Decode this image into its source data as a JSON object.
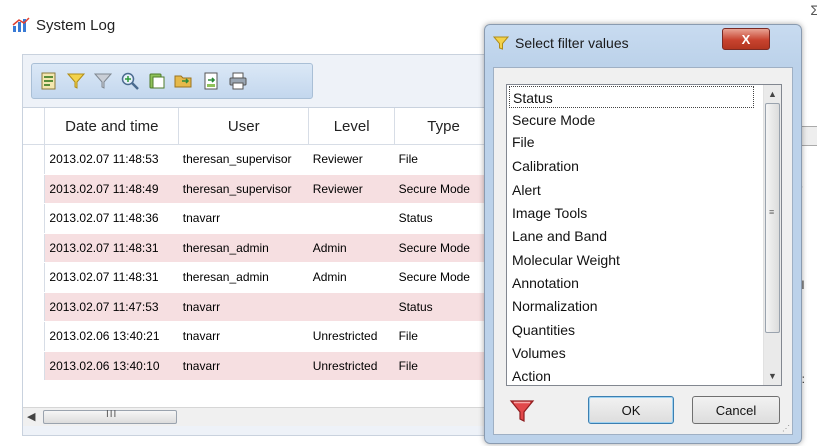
{
  "window": {
    "title": "System Log"
  },
  "toolbar": {
    "buttons": [
      "export-report-icon",
      "filter-icon",
      "clear-filter-icon",
      "zoom-icon",
      "copy-icon",
      "open-folder-icon",
      "save-icon",
      "print-icon"
    ]
  },
  "grid": {
    "columns": [
      "Date and time",
      "User",
      "Level",
      "Type"
    ],
    "rows": [
      {
        "datetime": "2013.02.07 11:48:53",
        "user": "theresan_supervisor",
        "level": "Reviewer",
        "type": "File",
        "shade": "white"
      },
      {
        "datetime": "2013.02.07 11:48:49",
        "user": "theresan_supervisor",
        "level": "Reviewer",
        "type": "Secure Mode",
        "shade": "pink"
      },
      {
        "datetime": "2013.02.07 11:48:36",
        "user": "tnavarr",
        "level": "",
        "type": "Status",
        "shade": "white"
      },
      {
        "datetime": "2013.02.07 11:48:31",
        "user": "theresan_admin",
        "level": "Admin",
        "type": "Secure Mode",
        "shade": "pink"
      },
      {
        "datetime": "2013.02.07 11:48:31",
        "user": "theresan_admin",
        "level": "Admin",
        "type": "Secure Mode",
        "shade": "white"
      },
      {
        "datetime": "2013.02.07 11:47:53",
        "user": "tnavarr",
        "level": "",
        "type": "Status",
        "shade": "pink"
      },
      {
        "datetime": "2013.02.06 13:40:21",
        "user": "tnavarr",
        "level": "Unrestricted",
        "type": "File",
        "shade": "white"
      },
      {
        "datetime": "2013.02.06 13:40:10",
        "user": "tnavarr",
        "level": "Unrestricted",
        "type": "File",
        "shade": "pink"
      }
    ],
    "scrollbar_grip": "III"
  },
  "right_edge_fragments": [
    "g",
    "Ir",
    "b",
    "al",
    "1:"
  ],
  "dialog": {
    "title": "Select filter values",
    "close_label": "X",
    "items": [
      "Status",
      "Secure Mode",
      "File",
      "Calibration",
      "Alert",
      "Image Tools",
      "Lane and Band",
      "Molecular Weight",
      "Annotation",
      "Normalization",
      "Quantities",
      "Volumes",
      "Action"
    ],
    "selected_item": "Status",
    "ok_label": "OK",
    "cancel_label": "Cancel"
  },
  "colors": {
    "pink_row": "#f6dfe1",
    "dialog_frame": "#bcd2ea",
    "close_red": "#c8432f"
  }
}
